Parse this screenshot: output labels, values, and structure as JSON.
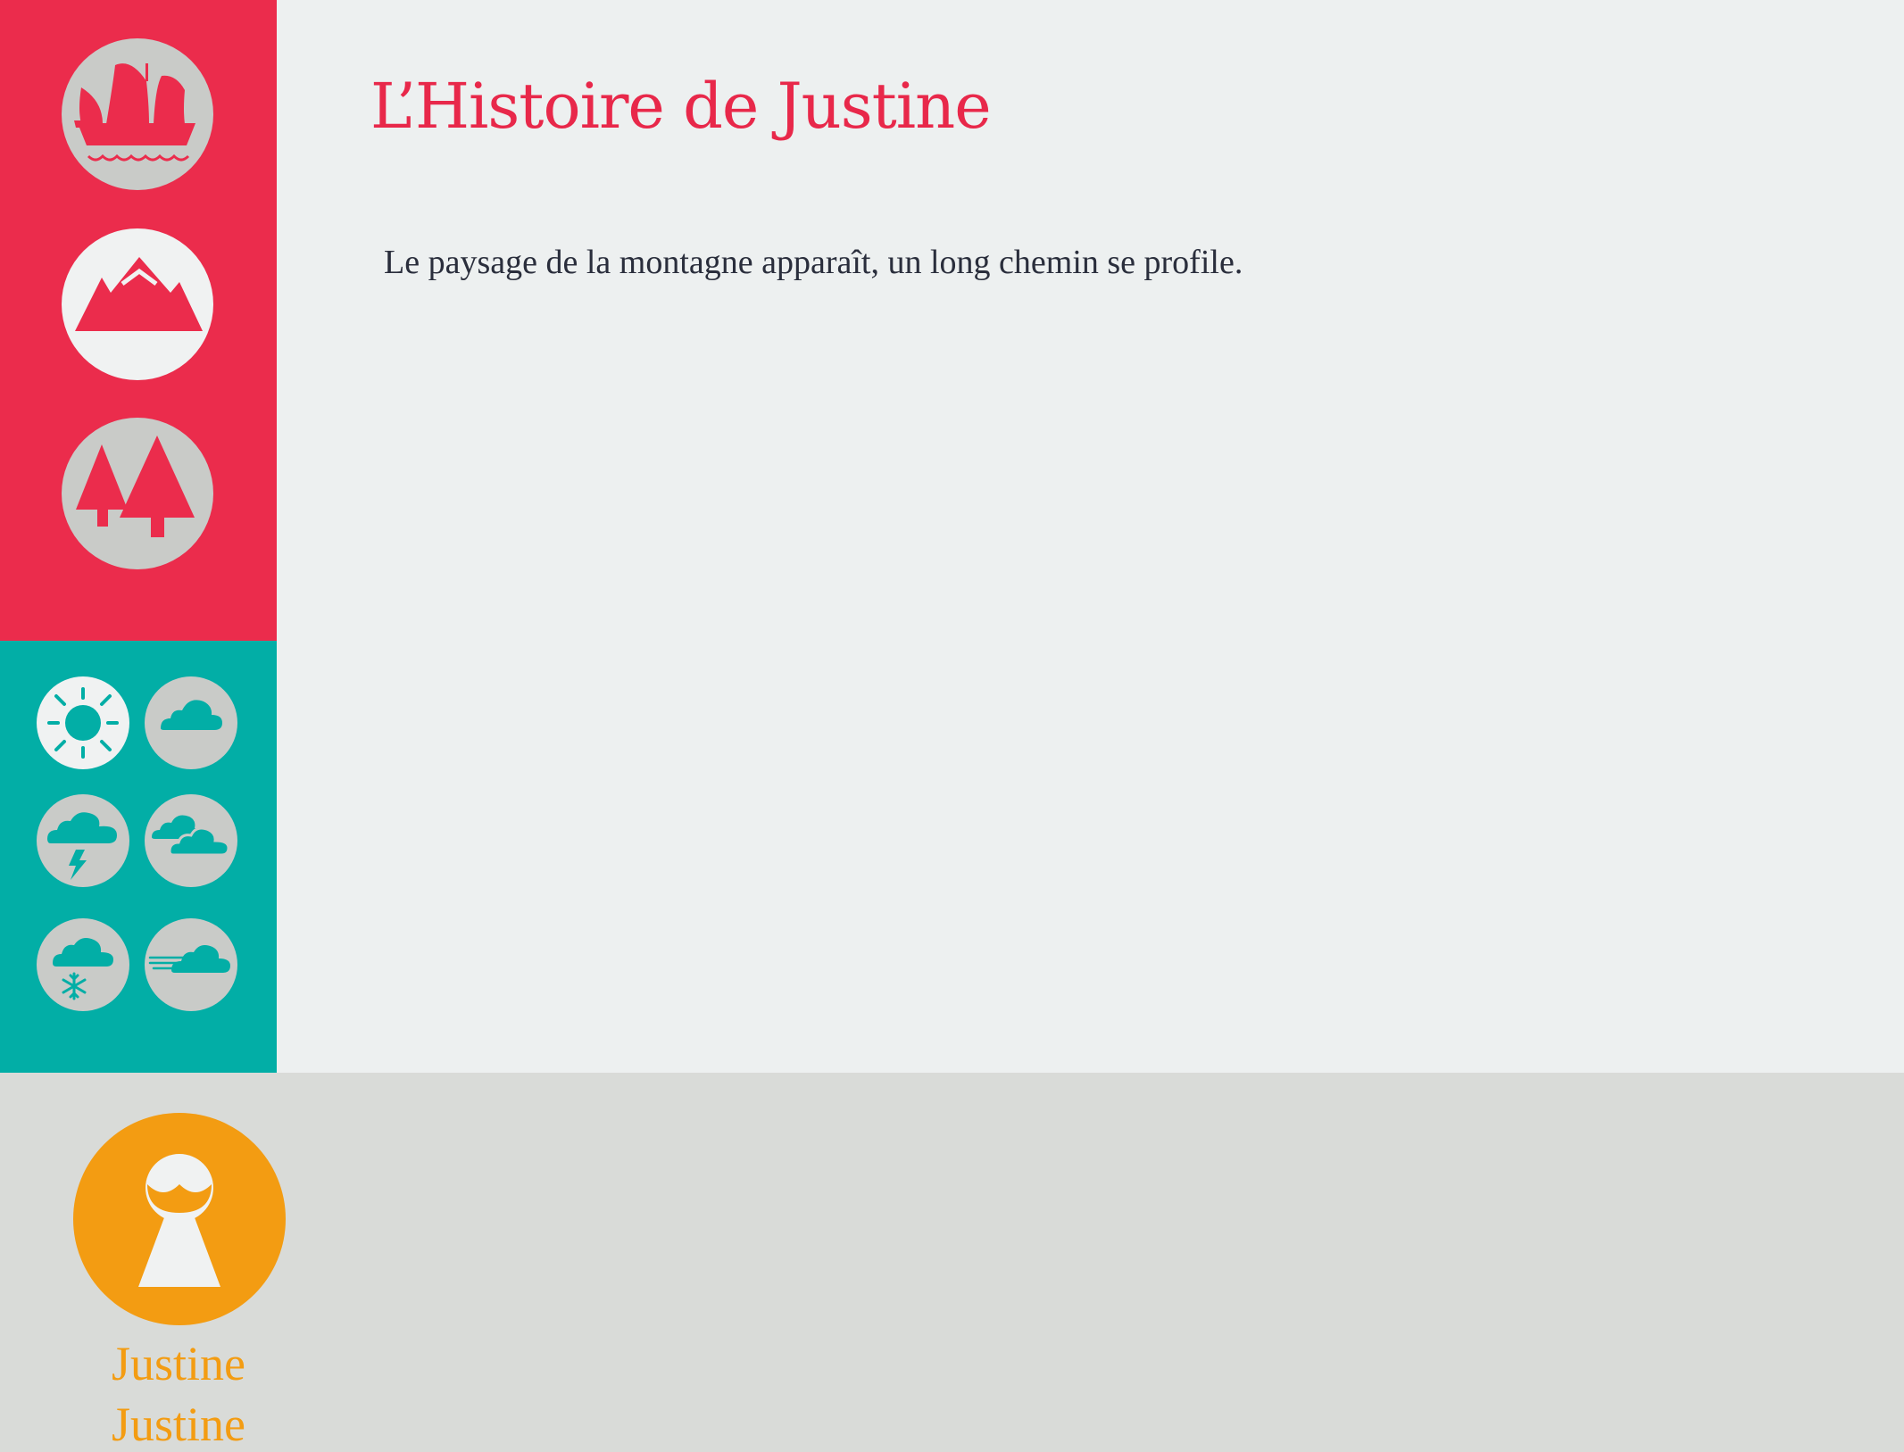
{
  "story": {
    "title": "L’Histoire de Justine",
    "text": "Le paysage de la montagne apparaît, un long chemin se profile."
  },
  "scenes": [
    {
      "icon": "junk-boat-icon",
      "selected": false
    },
    {
      "icon": "mountain-icon",
      "selected": true
    },
    {
      "icon": "pine-trees-icon",
      "selected": false
    }
  ],
  "weather": [
    {
      "icon": "sun-icon",
      "selected": true
    },
    {
      "icon": "cloud-icon",
      "selected": false
    },
    {
      "icon": "thunderstorm-icon",
      "selected": false
    },
    {
      "icon": "clouds-icon",
      "selected": false
    },
    {
      "icon": "snow-icon",
      "selected": false
    },
    {
      "icon": "wind-icon",
      "selected": false
    }
  ],
  "character": {
    "icon": "girl-keyhole-icon",
    "name": "Justine",
    "name_repeat": "Justine"
  },
  "colors": {
    "scene_panel": "#eb2c4c",
    "weather_panel": "#02aea6",
    "main_panel": "#edf0f0",
    "bottom_panel": "#d9dbd8",
    "title": "#e8284a",
    "character": "#f39c12",
    "selected_circle": "#f0f2f2",
    "idle_circle": "#c9cbc8"
  }
}
